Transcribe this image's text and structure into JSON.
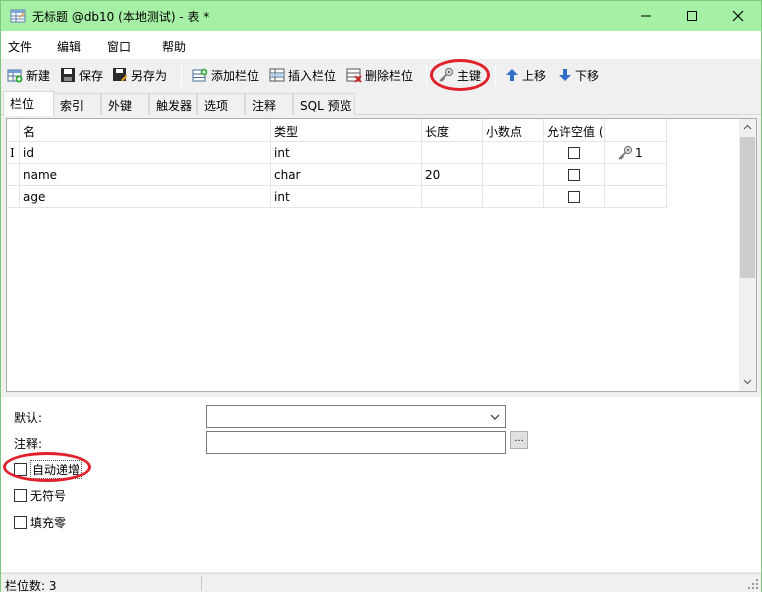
{
  "window": {
    "title": "无标题 @db10 (本地测试) - 表 *"
  },
  "menu": [
    "文件",
    "编辑",
    "窗口",
    "帮助"
  ],
  "toolbar": {
    "new_label": "新建",
    "save_label": "保存",
    "saveas_label": "另存为",
    "add_col_label": "添加栏位",
    "insert_col_label": "插入栏位",
    "delete_col_label": "删除栏位",
    "pk_label": "主键",
    "move_up_label": "上移",
    "move_down_label": "下移"
  },
  "tabs": [
    "栏位",
    "索引",
    "外键",
    "触发器",
    "选项",
    "注释",
    "SQL 预览"
  ],
  "grid": {
    "headers": [
      "名",
      "类型",
      "长度",
      "小数点",
      "允许空值 ("
    ],
    "rows": [
      {
        "name": "id",
        "type": "int",
        "length": "",
        "decimals": "",
        "nullable": false,
        "key": "1"
      },
      {
        "name": "name",
        "type": "char",
        "length": "20",
        "decimals": "",
        "nullable": false,
        "key": ""
      },
      {
        "name": "age",
        "type": "int",
        "length": "",
        "decimals": "",
        "nullable": false,
        "key": ""
      }
    ]
  },
  "props": {
    "default_label": "默认:",
    "comment_label": "注释:",
    "dots_label": "...",
    "auto_increment_label": "自动递增",
    "unsigned_label": "无符号",
    "zerofill_label": "填充零"
  },
  "status": {
    "text": "栏位数: 3"
  },
  "colors": {
    "titlebar": "#a6f0a6",
    "highlight": "#e0202a"
  }
}
